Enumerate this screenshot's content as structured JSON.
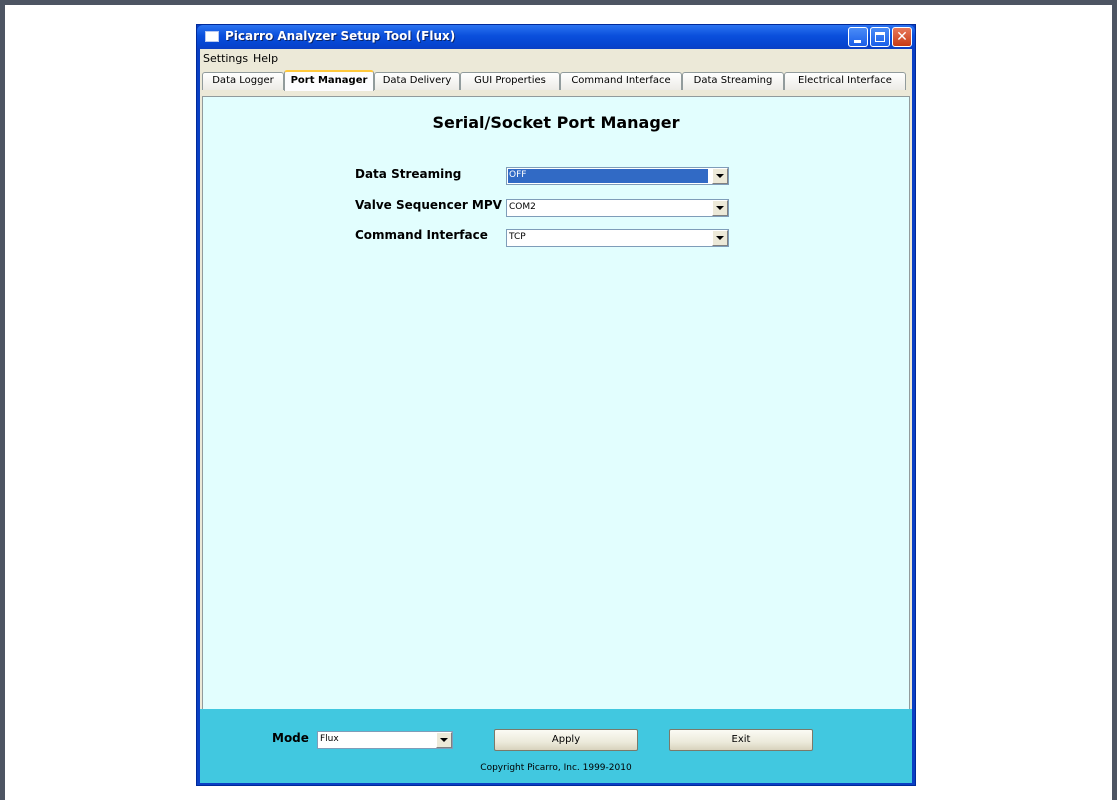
{
  "window": {
    "title": "Picarro Analyzer Setup Tool (Flux)"
  },
  "menu": {
    "items": [
      {
        "label": "Settings"
      },
      {
        "label": "Help"
      }
    ]
  },
  "tabs": [
    {
      "label": "Data Logger",
      "active": false
    },
    {
      "label": "Port Manager",
      "active": true
    },
    {
      "label": "Data Delivery",
      "active": false
    },
    {
      "label": "GUI Properties",
      "active": false
    },
    {
      "label": "Command Interface",
      "active": false
    },
    {
      "label": "Data Streaming",
      "active": false
    },
    {
      "label": "Electrical Interface",
      "active": false
    }
  ],
  "panel": {
    "title": "Serial/Socket Port Manager",
    "fields": [
      {
        "label": "Data Streaming",
        "value": "OFF",
        "selected": true
      },
      {
        "label": "Valve Sequencer MPV",
        "value": "COM2",
        "selected": false
      },
      {
        "label": "Command Interface",
        "value": "TCP",
        "selected": false
      }
    ]
  },
  "bottom": {
    "mode_label": "Mode",
    "mode_value": "Flux",
    "apply_label": "Apply",
    "exit_label": "Exit",
    "copyright": "Copyright Picarro, Inc. 1999-2010"
  },
  "colors": {
    "panel_background": "#e2fefe",
    "bottom_bar": "#41c8e0",
    "selection": "#316ac5",
    "titlebar": "#0a4fdc"
  }
}
